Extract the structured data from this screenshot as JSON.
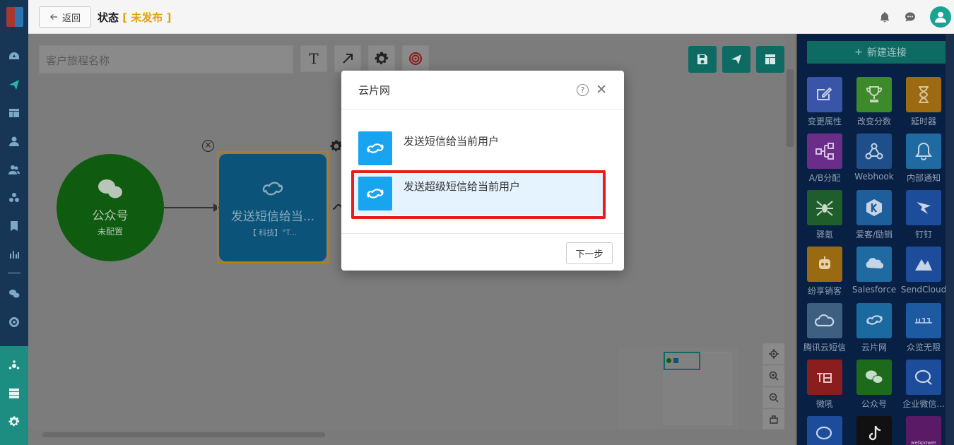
{
  "topbar": {
    "back_label": "返回",
    "title_prefix": "状态",
    "bracket_open": "[",
    "status": "未发布",
    "bracket_close": "]"
  },
  "canvas": {
    "journey_name_placeholder": "客户旅程名称",
    "tool_text_label": "T",
    "nodes": [
      {
        "title": "公众号",
        "subtitle": "未配置"
      },
      {
        "title": "发送短信给当...",
        "subtitle": "【 科技】\"T..."
      }
    ]
  },
  "right_panel": {
    "new_connection_label": "新建连接",
    "plugins": [
      {
        "label": "变更属性",
        "icon": "edit-icon",
        "color": "#3a55a8"
      },
      {
        "label": "改变分数",
        "icon": "trophy-icon",
        "color": "#3c8a2a"
      },
      {
        "label": "延时器",
        "icon": "hourglass-icon",
        "color": "#9c6a10"
      },
      {
        "label": "A/B分配",
        "icon": "ab-split-icon",
        "color": "#6a2d8a"
      },
      {
        "label": "Webhook",
        "icon": "webhook-icon",
        "color": "#1e4f8a"
      },
      {
        "label": "内部通知",
        "icon": "bell-icon",
        "color": "#1f6aa1"
      },
      {
        "label": "驿氪",
        "icon": "spider-icon",
        "color": "#1f5d2c"
      },
      {
        "label": "爱客/励销",
        "icon": "aike-icon",
        "color": "#1e5f9b"
      },
      {
        "label": "钉钉",
        "icon": "dingtalk-icon",
        "color": "#1d4d9a"
      },
      {
        "label": "纷享销客",
        "icon": "fxiaoke-icon",
        "color": "#9a6a12"
      },
      {
        "label": "Salesforce",
        "icon": "salesforce-icon",
        "color": "#1f6aa1"
      },
      {
        "label": "SendCloud",
        "icon": "sendcloud-icon",
        "color": "#1d4d9a"
      },
      {
        "label": "腾讯云短信",
        "icon": "tencent-cloud-icon",
        "color": "#3e5f80"
      },
      {
        "label": "云片网",
        "icon": "yunpian-icon",
        "color": "#1a6aa0"
      },
      {
        "label": "众览无限",
        "icon": "webpower-brand-icon",
        "color": "#1d5aa1"
      },
      {
        "label": "微吼",
        "icon": "vhall-icon",
        "color": "#8a1d1d"
      },
      {
        "label": "公众号",
        "icon": "wechat-icon",
        "color": "#1d6a1d"
      },
      {
        "label": "企业微信...",
        "icon": "wecom-icon",
        "color": "#1d4d9a"
      },
      {
        "label": "",
        "icon": "chat-icon",
        "color": "#1d4d9a"
      },
      {
        "label": "",
        "icon": "tiktok-icon",
        "color": "#111111"
      },
      {
        "label": "webpower",
        "icon": "webpower-icon",
        "color": "#5a1a66"
      }
    ]
  },
  "modal": {
    "title": "云片网",
    "options": [
      {
        "label": "发送短信给当前用户"
      },
      {
        "label": "发送超级短信给当前用户"
      }
    ],
    "next_label": "下一步"
  }
}
